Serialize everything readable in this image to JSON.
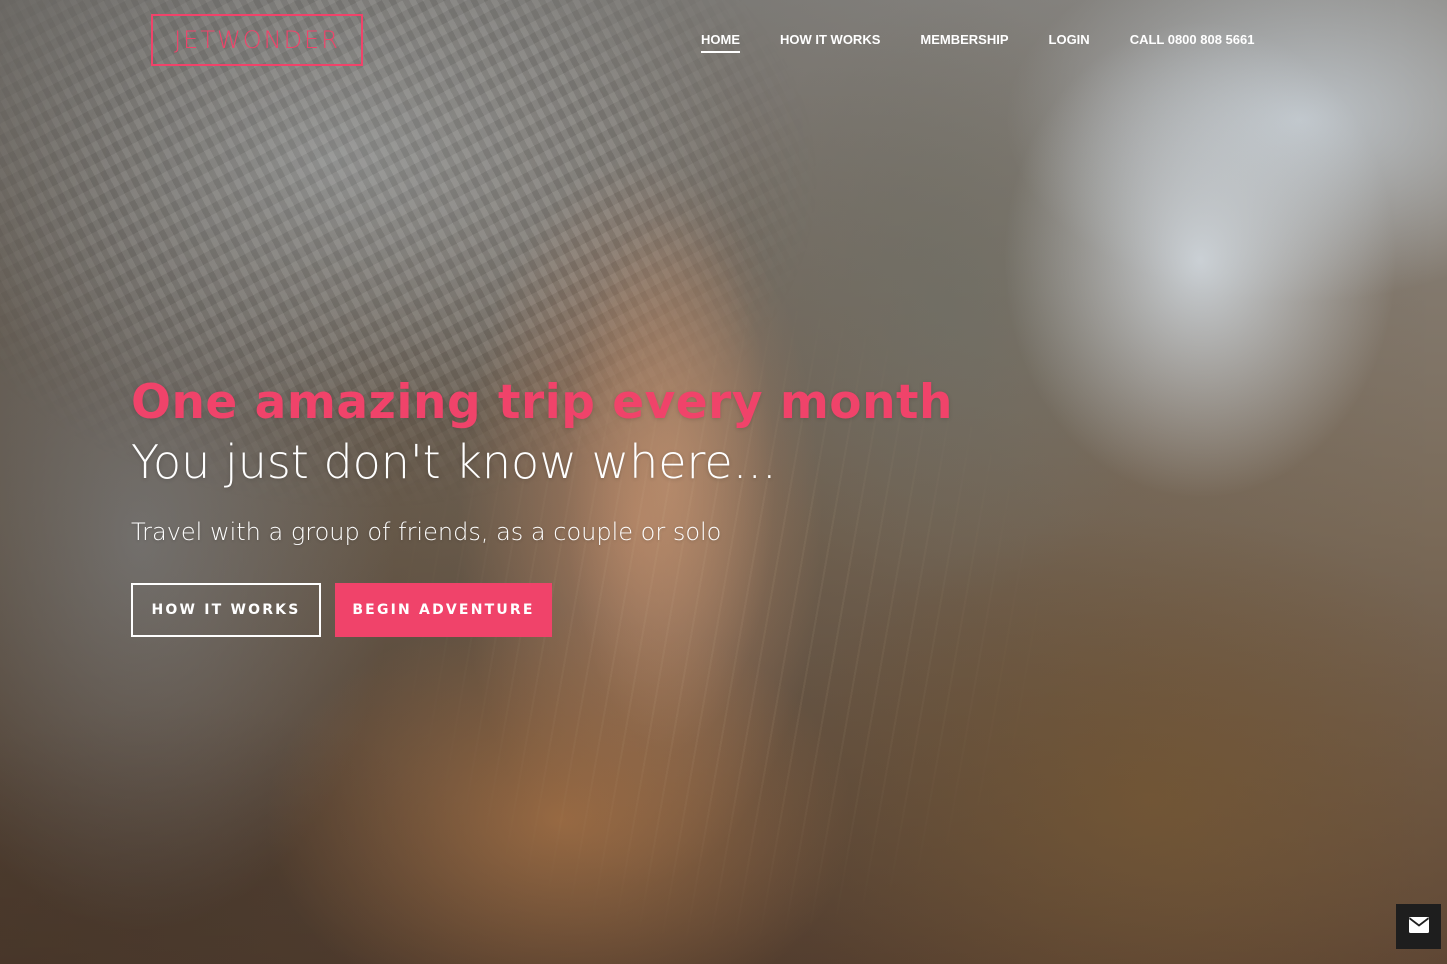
{
  "brand": {
    "logo_text": "JETWONDER",
    "accent_color": "#f0436a"
  },
  "nav": {
    "items": [
      {
        "label": "HOME",
        "active": true
      },
      {
        "label": "HOW IT WORKS",
        "active": false
      },
      {
        "label": "MEMBERSHIP",
        "active": false
      },
      {
        "label": "LOGIN",
        "active": false
      },
      {
        "label": "CALL 0800 808 5661",
        "active": false
      }
    ]
  },
  "hero": {
    "headline": "One amazing trip every month",
    "subheadline": "You just don't know where...",
    "tagline": "Travel with a group of friends, as a couple or solo",
    "buttons": {
      "secondary_label": "HOW IT WORKS",
      "primary_label": "BEGIN ADVENTURE"
    },
    "background_image": "woman in knit hat, profile, sunset"
  },
  "contact_widget": {
    "icon": "envelope-icon"
  }
}
